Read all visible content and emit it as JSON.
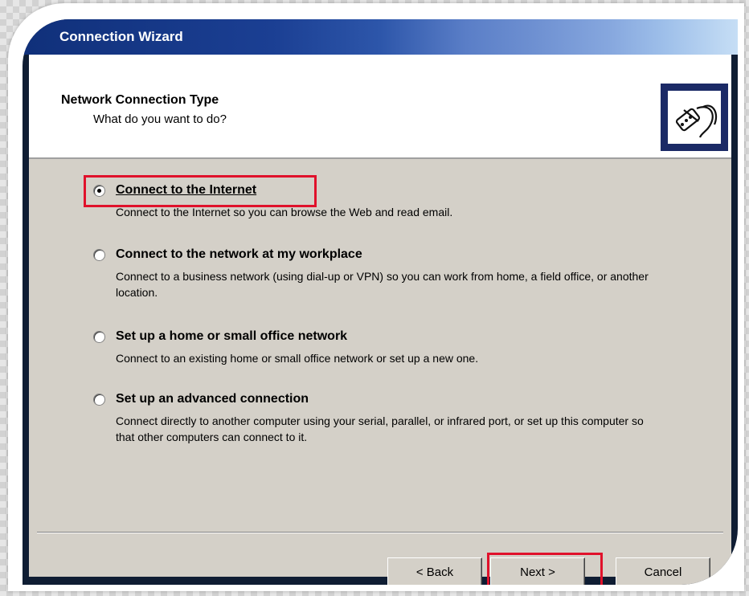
{
  "window": {
    "title": "Connection Wizard"
  },
  "header": {
    "title": "Network Connection Type",
    "subtitle": "What do you want to do?",
    "icon": "network-connection-icon"
  },
  "options": [
    {
      "label": "Connect to the Internet",
      "description": "Connect to the Internet so you can browse the Web and read email.",
      "selected": true
    },
    {
      "label": "Connect to the network at my workplace",
      "description": "Connect to a business network (using dial-up or VPN) so you can work from home, a field office, or another location.",
      "selected": false
    },
    {
      "label": "Set up a home or small office network",
      "description": "Connect to an existing home or small office network or set up a new one.",
      "selected": false
    },
    {
      "label": "Set up an advanced connection",
      "description": "Connect directly to another computer using your serial, parallel, or infrared port, or set up this computer so that other computers can connect to it.",
      "selected": false
    }
  ],
  "buttons": {
    "back": "< Back",
    "next": "Next >",
    "cancel": "Cancel"
  },
  "colors": {
    "highlight": "#e0112b",
    "titlebar": "#1b3f93",
    "dialog": "#d4d0c8"
  }
}
